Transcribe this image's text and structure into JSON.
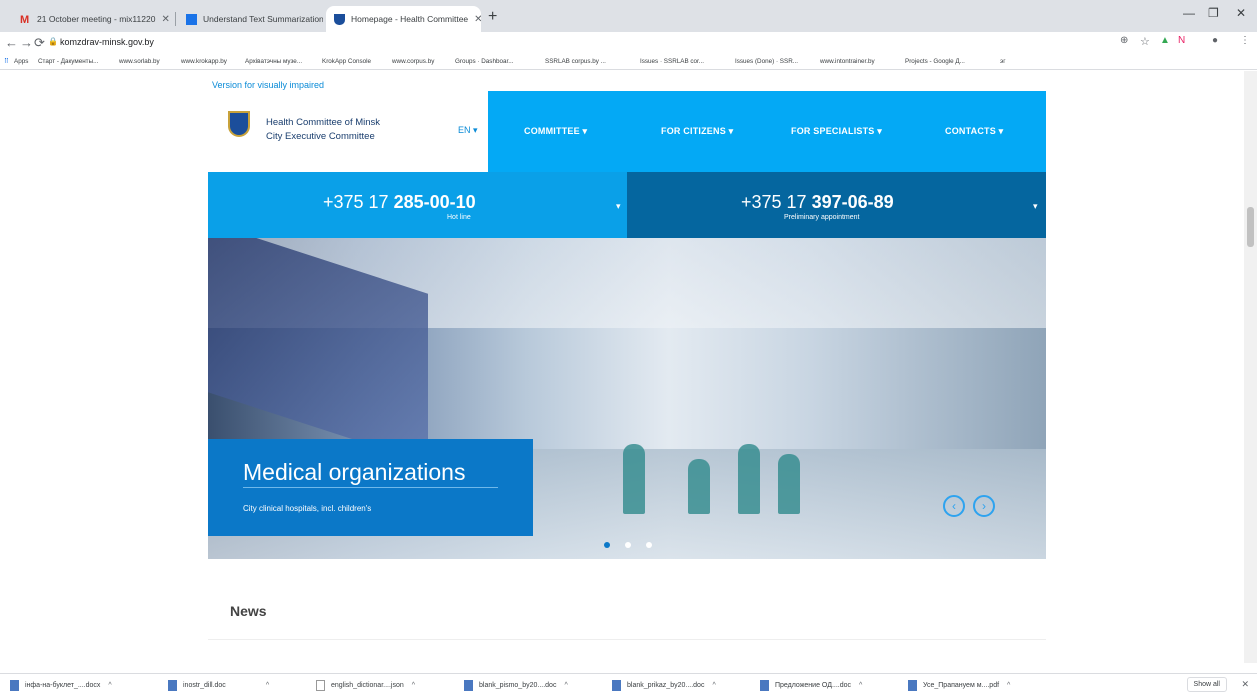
{
  "browser": {
    "tabs": [
      {
        "label": "21 October meeting - mix11220 ",
        "icon": "gmail-icon"
      },
      {
        "label": "Understand Text Summarization ",
        "icon": "doc-icon"
      },
      {
        "label": "Homepage - Health Committee",
        "icon": "crest-icon"
      }
    ],
    "new_tab": "+",
    "url": "komzdrav-minsk.gov.by",
    "bookmarks": [
      "Apps",
      "Старт - Дакументы...",
      "www.sorlab.by",
      "www.krokapp.by",
      "Архіватэчны музе...",
      "KrokApp Console",
      "www.corpus.by",
      "Groups · Dashboar...",
      "SSRLAB corpus.by ...",
      "Issues · SSRLAB cor...",
      "Issues (Done) · SSR...",
      "www.intontrainer.by",
      "Projects - Google Д...",
      "эг"
    ]
  },
  "site": {
    "visually_impaired": "Version for visually impaired",
    "org_line1": "Health Committee of Minsk",
    "org_line2": "City Executive Committee",
    "lang": "EN ▾",
    "nav": [
      "COMMITTEE ▾",
      "FOR CITIZENS ▾",
      "FOR SPECIALISTS ▾",
      "CONTACTS ▾"
    ],
    "phones": [
      {
        "prefix": "+375 17 ",
        "number": "285-00-10",
        "note": "Hot line"
      },
      {
        "prefix": "+375 17 ",
        "number": "397-06-89",
        "note": "Preliminary appointment"
      }
    ],
    "slide": {
      "title": "Medical organizations",
      "subtitle": "City clinical hospitals, incl. children's",
      "total_slides": 3,
      "active_slide": 1
    },
    "news_heading": "News"
  },
  "downloads": [
    "інфа-на-буклет_....docx",
    "inostr_dill.doc",
    "english_dictionar....json",
    "blank_pismo_by20....doc",
    "blank_prikaz_by20....doc",
    "Предложение ОД....doc",
    "Усе_Прапануем м....pdf"
  ],
  "downloads_show_all": "Show all"
}
